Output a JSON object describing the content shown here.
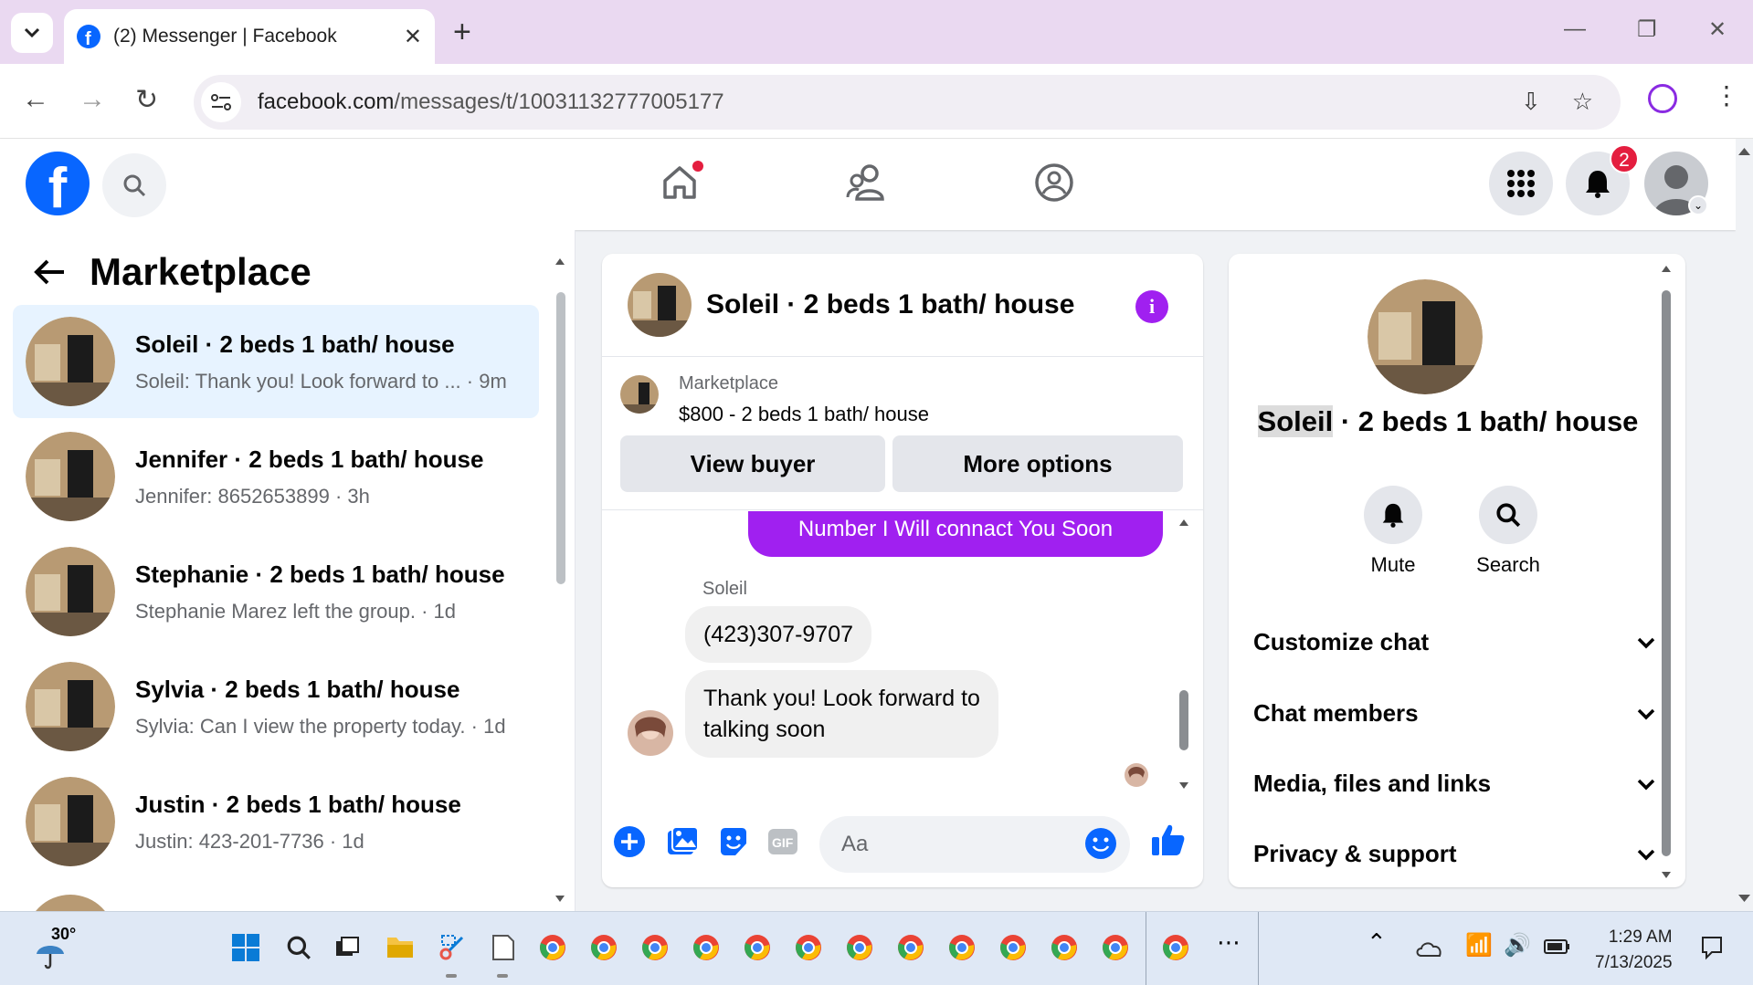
{
  "browser": {
    "tab_title": "(2) Messenger | Facebook",
    "url_host": "facebook.com",
    "url_path": "/messages/t/10031132777005177"
  },
  "fb": {
    "notification_count": "2"
  },
  "left_panel": {
    "title": "Marketplace",
    "conversations": [
      {
        "name": "Soleil · 2 beds 1 bath/ house",
        "preview": "Soleil: Thank you! Look forward to ... · 9m"
      },
      {
        "name": "Jennifer · 2 beds 1 bath/ house",
        "preview": "Jennifer: 8652653899 · 3h"
      },
      {
        "name": "Stephanie · 2 beds 1 bath/ house",
        "preview": "Stephanie Marez left the group. · 1d"
      },
      {
        "name": "Sylvia · 2 beds 1 bath/ house",
        "preview": "Sylvia: Can I view the property today. · 1d"
      },
      {
        "name": "Justin · 2 beds 1 bath/ house",
        "preview": "Justin: 423-201-7736 · 1d"
      }
    ]
  },
  "chat": {
    "title": "Soleil · 2 beds 1 bath/ house",
    "marketplace_label": "Marketplace",
    "listing": "$800 - 2 beds 1 bath/ house",
    "view_buyer": "View buyer",
    "more_options": "More options",
    "outgoing_message": "Number I Will connact You Soon",
    "sender": "Soleil",
    "incoming_1": "(423)307-9707",
    "incoming_2_line1": "Thank you! Look forward to",
    "incoming_2_line2": "talking soon",
    "composer_placeholder": "Aa"
  },
  "info_panel": {
    "name_highlight": "Soleil",
    "name_rest": " · 2 beds 1 bath/ house",
    "mute": "Mute",
    "search": "Search",
    "sections": [
      "Customize chat",
      "Chat members",
      "Media, files and links",
      "Privacy & support"
    ]
  },
  "taskbar": {
    "temperature": "30°",
    "time": "1:29 AM",
    "date": "7/13/2025"
  },
  "colors": {
    "fb_blue": "#0866ff",
    "messenger_purple": "#a020f0",
    "active_row": "#e7f3ff"
  }
}
